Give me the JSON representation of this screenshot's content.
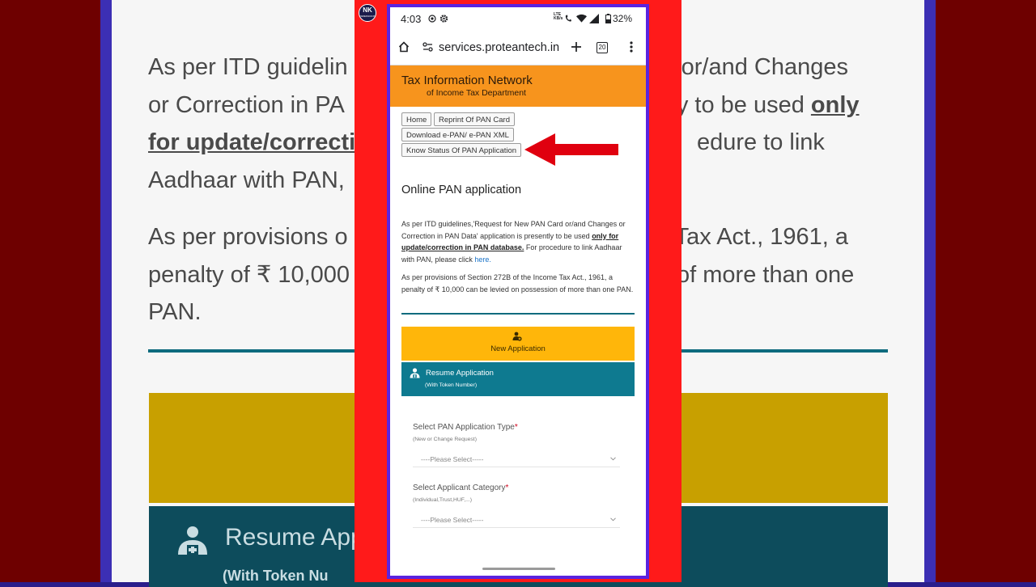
{
  "channel": {
    "logo_top": "NK",
    "logo_bottom": "DIMENSIONS"
  },
  "background": {
    "para1_a": "As per ITD guidelin",
    "para1_b": "or/and Changes",
    "para1_c": "or Correction in PA",
    "para1_d": "y to be used ",
    "para1_e": "only",
    "para1_f": "for update/correctio",
    "para1_g": "edure to link",
    "para1_h": "Aadhaar with PAN,",
    "para2_a": "As per provisions o",
    "para2_b": "Tax Act., 1961, a",
    "para2_c": "penalty of ₹ 10,000",
    "para2_d": "of more than one",
    "para2_e": "PAN.",
    "resume_title": "Resume App",
    "resume_sub": "(With Token Nu"
  },
  "status_bar": {
    "time": "4:03",
    "network_top": "LTE",
    "network_bottom": "KB/s",
    "battery": "32%"
  },
  "browser": {
    "url": "services.proteantech.in",
    "tab_count": "20"
  },
  "site": {
    "banner_title": "Tax Information Network",
    "banner_subtitle": "of Income Tax Department",
    "nav": {
      "home": "Home",
      "reprint": "Reprint Of PAN Card",
      "download": "Download e-PAN/ e-PAN XML",
      "know_status": "Know Status Of PAN Application"
    },
    "heading": "Online PAN application",
    "para1_pre": "As per ITD guidelines,'Request for New PAN Card or/and Changes or Correction in PAN Data' application is presently to be used ",
    "para1_underline": "only for update/correction in PAN database.",
    "para1_post": " For procedure to link Aadhaar with PAN, please click ",
    "para1_link": "here.",
    "para2": "As per provisions of Section 272B of the Income Tax Act., 1961, a penalty of ₹ 10,000 can be levied on possession of more than one PAN.",
    "new_application": "New Application",
    "resume_application": "Resume Application",
    "resume_sub": "(With Token Number)",
    "field1_label": "Select PAN Application Type",
    "field1_hint": "(New or Change Request)",
    "field1_placeholder": "----Please Select-----",
    "field2_label": "Select Applicant Category",
    "field2_hint": "(Individual,Trust,HUF,...)",
    "field2_placeholder": "----Please Select-----",
    "required_mark": "*"
  },
  "colors": {
    "banner": "#f7941d",
    "new_app": "#ffb60a",
    "resume_app": "#0e7a90",
    "arrow": "#e0000f",
    "phone_border": "#5a24e0",
    "side_panel": "#ff1a1a"
  }
}
